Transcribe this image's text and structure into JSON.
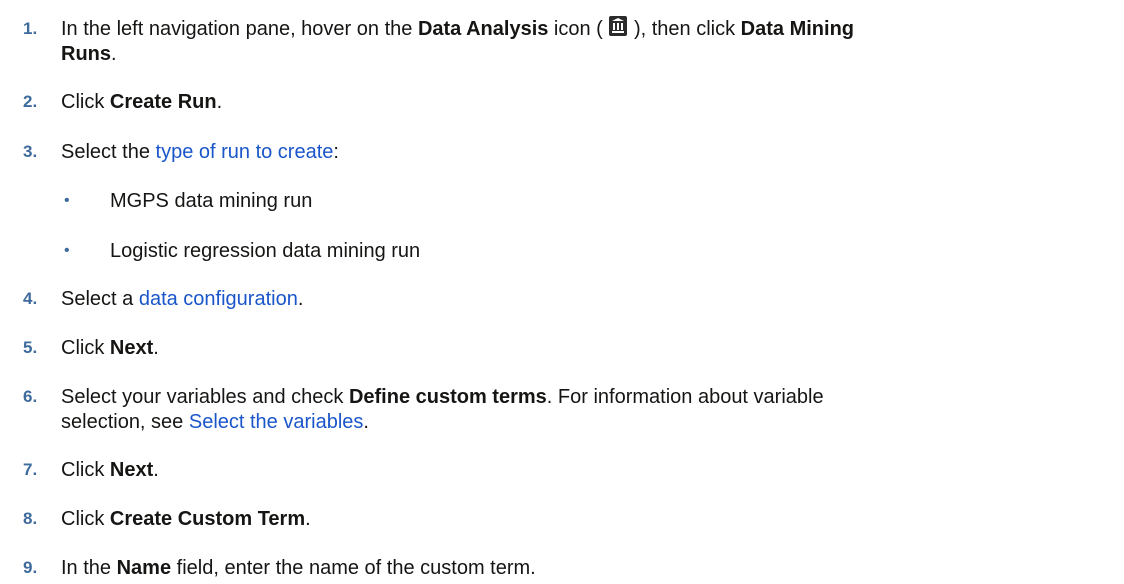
{
  "steps": [
    {
      "num": "1.",
      "p1": "In the left navigation pane, hover on the ",
      "b1": "Data Analysis",
      "p2": " icon ( ",
      "icon": "data-analysis-icon",
      "p3": " ), then click ",
      "b2": "Data Mining",
      "b3": "Runs",
      "p4": "."
    },
    {
      "num": "2.",
      "p1": "Click ",
      "b1": "Create Run",
      "p2": "."
    },
    {
      "num": "3.",
      "p1": "Select the ",
      "link": "type of run to create",
      "p2": ":"
    },
    {
      "num": "4.",
      "p1": "Select a ",
      "link": "data configuration",
      "p2": "."
    },
    {
      "num": "5.",
      "p1": "Click ",
      "b1": "Next",
      "p2": "."
    },
    {
      "num": "6.",
      "p1": "Select your variables and check ",
      "b1": "Define custom terms",
      "p2": ". For information about variable",
      "p3": "selection, see ",
      "link": "Select the variables",
      "p4": "."
    },
    {
      "num": "7.",
      "p1": "Click ",
      "b1": "Next",
      "p2": "."
    },
    {
      "num": "8.",
      "p1": "Click ",
      "b1": "Create Custom Term",
      "p2": "."
    },
    {
      "num": "9.",
      "p1": "In the ",
      "b1": "Name",
      "p2": " field, enter the name of the custom term."
    }
  ],
  "run_types": [
    {
      "bullet": "•",
      "label": "MGPS data mining run"
    },
    {
      "bullet": "•",
      "label": "Logistic regression data mining run"
    }
  ],
  "colors": {
    "step_number": "#3e6b9c",
    "link": "#1a56c9",
    "text": "#161513"
  }
}
